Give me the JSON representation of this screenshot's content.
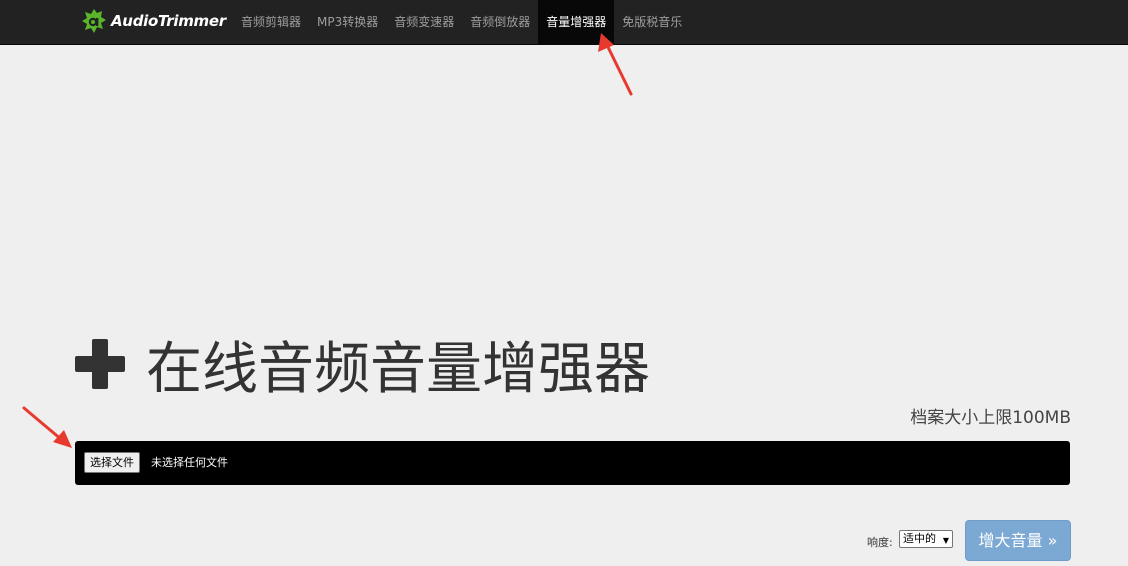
{
  "brand": {
    "name": "AudioTrimmer",
    "logo_color": "#5ab52b"
  },
  "nav": {
    "items": [
      {
        "label": "音频剪辑器",
        "active": false
      },
      {
        "label": "MP3转换器",
        "active": false
      },
      {
        "label": "音频变速器",
        "active": false
      },
      {
        "label": "音频倒放器",
        "active": false
      },
      {
        "label": "音量增强器",
        "active": true
      },
      {
        "label": "免版税音乐",
        "active": false
      }
    ]
  },
  "main": {
    "title": "在线音频音量增强器",
    "title_icon": "plus-icon",
    "size_limit": "档案大小上限100MB"
  },
  "upload": {
    "choose_button": "选择文件",
    "no_file": "未选择任何文件"
  },
  "controls": {
    "loudness_label": "响度:",
    "loudness_value": "适中的",
    "boost_button": "增大音量 »",
    "boost_color": "#7ca8d4"
  },
  "annotations": {
    "arrow_color": "#e8392e"
  }
}
